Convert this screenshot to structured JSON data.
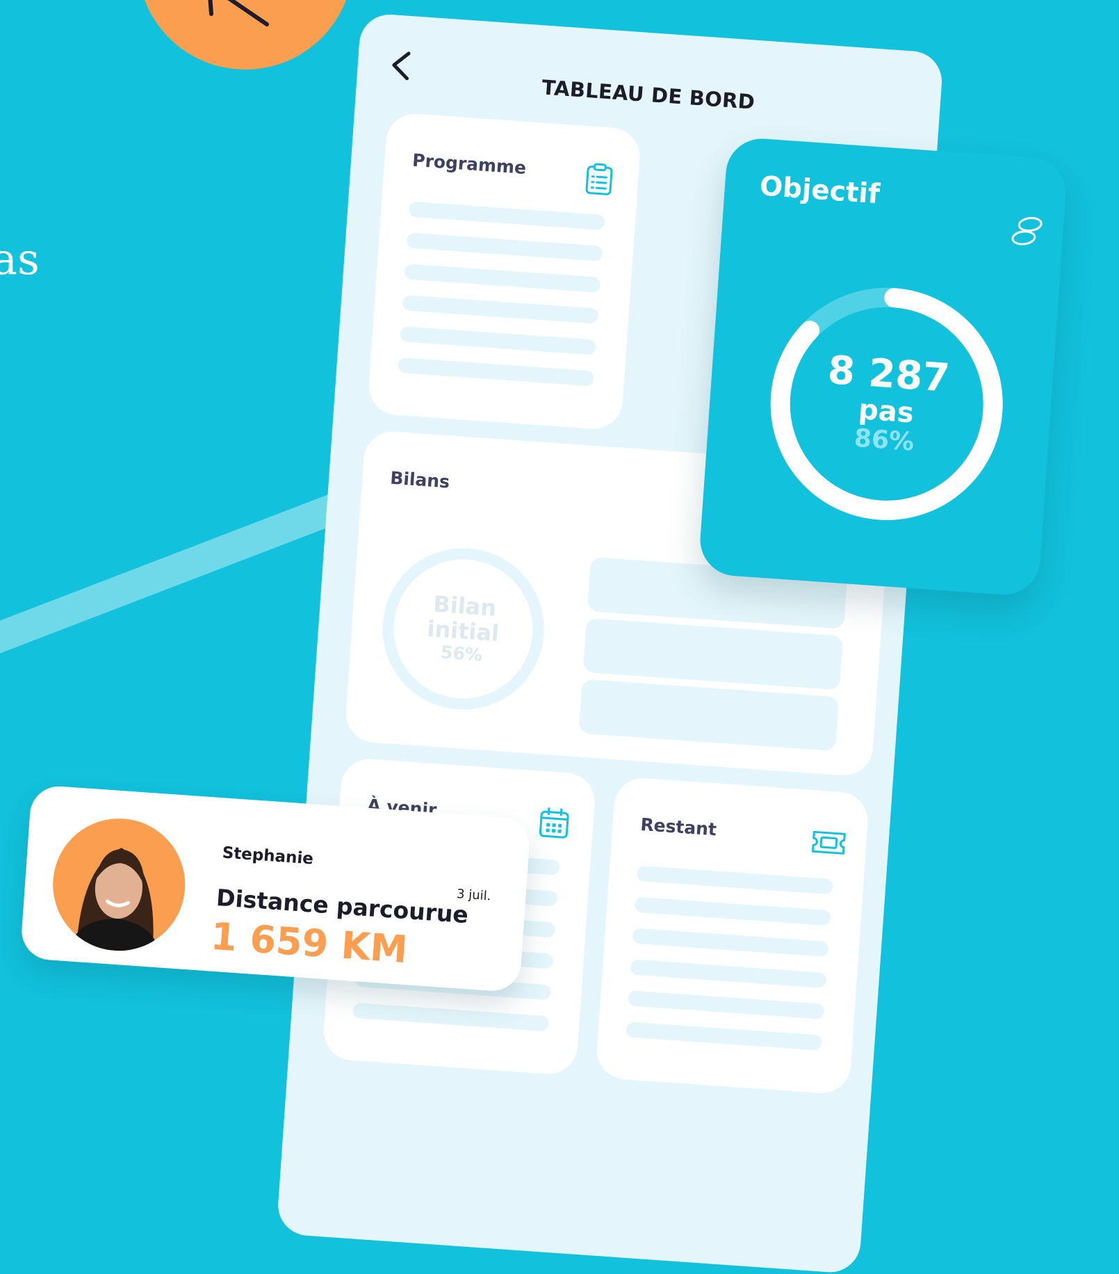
{
  "background": {
    "partial_text": "as",
    "primary": "#12C1DC",
    "accent": "#FC9E50"
  },
  "header": {
    "title": "TABLEAU DE BORD",
    "back_icon": "chevron-left-icon"
  },
  "cards": {
    "programme": {
      "title": "Programme",
      "icon": "clipboard-list-icon"
    },
    "bilans": {
      "title": "Bilans",
      "ring_line1": "Bilan",
      "ring_line2": "initial",
      "ring_pct": "56%",
      "ring_progress": 0.56
    },
    "a_venir": {
      "title": "À venir",
      "icon": "calendar-icon"
    },
    "restant": {
      "title": "Restant",
      "icon": "ticket-icon"
    }
  },
  "objectif": {
    "title": "Objectif",
    "icon": "footsteps-icon",
    "steps": "8 287",
    "unit": "pas",
    "percent_label": "86%",
    "progress": 0.86
  },
  "activity": {
    "name": "Stephanie",
    "date": "3 juil.",
    "label": "Distance parcourue",
    "value": "1 659 KM",
    "avatar": "user-photo-avatar"
  }
}
